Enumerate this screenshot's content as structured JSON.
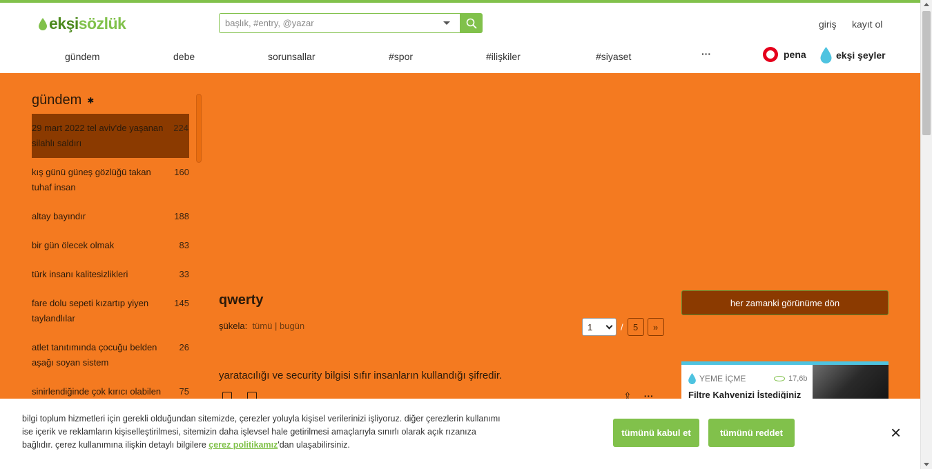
{
  "header": {
    "logo_prefix": "ekşi",
    "logo_suffix": "sözlük",
    "search_placeholder": "başlık, #entry, @yazar",
    "login": "giriş",
    "register": "kayıt ol"
  },
  "nav": {
    "items": [
      "gündem",
      "debe",
      "sorunsallar",
      "#spor",
      "#ilişkiler",
      "#siyaset",
      "···"
    ],
    "pena": "pena",
    "seyler": "ekşi şeyler"
  },
  "sidebar": {
    "title": "gündem",
    "topics": [
      {
        "title": "29 mart 2022 tel aviv'de yaşanan silahlı saldırı",
        "count": "224"
      },
      {
        "title": "kış günü güneş gözlüğü takan tuhaf insan",
        "count": "160"
      },
      {
        "title": "altay bayındır",
        "count": "188"
      },
      {
        "title": "bir gün ölecek olmak",
        "count": "83"
      },
      {
        "title": "türk insanı kalitesizlikleri",
        "count": "33"
      },
      {
        "title": "fare dolu sepeti kızartıp yiyen taylandlılar",
        "count": "145"
      },
      {
        "title": "atlet tanıtımında çocuğu belden aşağı soyan sistem",
        "count": "26"
      },
      {
        "title": "sinirlendiğinde çok kırıcı olabilen",
        "count": "75"
      }
    ]
  },
  "main": {
    "topic_title": "qwerty",
    "sukela_label": "şükela:",
    "sukela_all": "tümü",
    "sukela_sep": "|",
    "sukela_today": "bugün",
    "page_current": "1",
    "page_sep": "/",
    "page_total": "5",
    "page_next": "»",
    "entry_text": "yaratacılığı ve security bilgisi sıfır insanların kullandığı şifredir."
  },
  "right": {
    "classic_button": "her zamanki görünüme dön",
    "card_category": "YEME İÇME",
    "card_views": "17,6b",
    "card_title": "Filtre Kahvenizi İstediğiniz"
  },
  "cookie": {
    "text_1": "bilgi toplum hizmetleri için gerekli olduğundan sitemizde, çerezler yoluyla kişisel verilerinizi işliyoruz. diğer çerezlerin kullanımı ise içerik ve reklamların kişiselleştirilmesi, sitemizin daha işlevsel hale getirilmesi amaçlarıyla sınırlı olarak açık rızanıza bağlıdır. çerez kullanımına ilişkin detaylı bilgilere ",
    "link": "çerez politikamız",
    "text_2": "'dan ulaşabilirsiniz.",
    "accept": "tümünü kabul et",
    "reject": "tümünü reddet",
    "close": "×"
  },
  "colors": {
    "brand_green": "#81c14b",
    "page_orange": "#f47a20",
    "selected_brown": "#8b3a00"
  }
}
